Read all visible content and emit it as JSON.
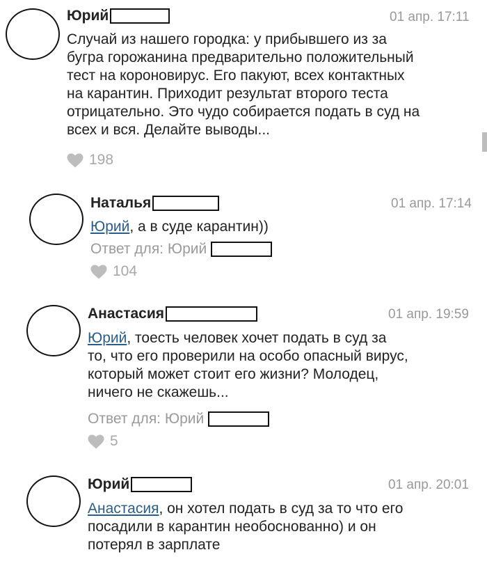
{
  "comments": [
    {
      "author": "Юрий",
      "date": "01 апр. 17:11",
      "text_lines": [
        "Случай из нашего городка: у прибывшего из за",
        "бугра горожанина предварительно положительный",
        "тест на короновирус. Его пакуют, всех контактных",
        "на карантин. Приходит результат второго теста",
        "отрицательно. Это чудо собирается подать в суд на",
        "всех и вся. Делайте выводы..."
      ],
      "likes": "198"
    },
    {
      "author": "Наталья",
      "date": "01 апр. 17:14",
      "mention": "Юрий",
      "first_line_rest": ", а в суде карантин))",
      "reply_to": "Ответ для: Юрий",
      "likes": "104"
    },
    {
      "author": "Анастасия",
      "date": "01 апр. 19:59",
      "mention": "Юрий",
      "first_line_rest": ", тоесть человек хочет подать в суд за",
      "text_lines": [
        "то, что его проверили на особо опасный вирус,",
        "который может стоит его жизни? Молодец,",
        "ничего не скажешь..."
      ],
      "reply_to": "Ответ для: Юрий",
      "likes": "5"
    },
    {
      "author": "Юрий",
      "date": "01 апр. 20:01",
      "mention": "Анастасия",
      "first_line_rest": ", он хотел подать в суд за то что его",
      "text_lines": [
        "посадили в карантин необоснованно) и он",
        "потерял в зарплате"
      ]
    }
  ],
  "colors": {
    "text": "#222222",
    "date": "#999999",
    "mention": "#2b5d8a",
    "muted": "#9a9a9a",
    "heart": "#bdbdbd"
  },
  "icons": {
    "like": "heart-icon"
  }
}
